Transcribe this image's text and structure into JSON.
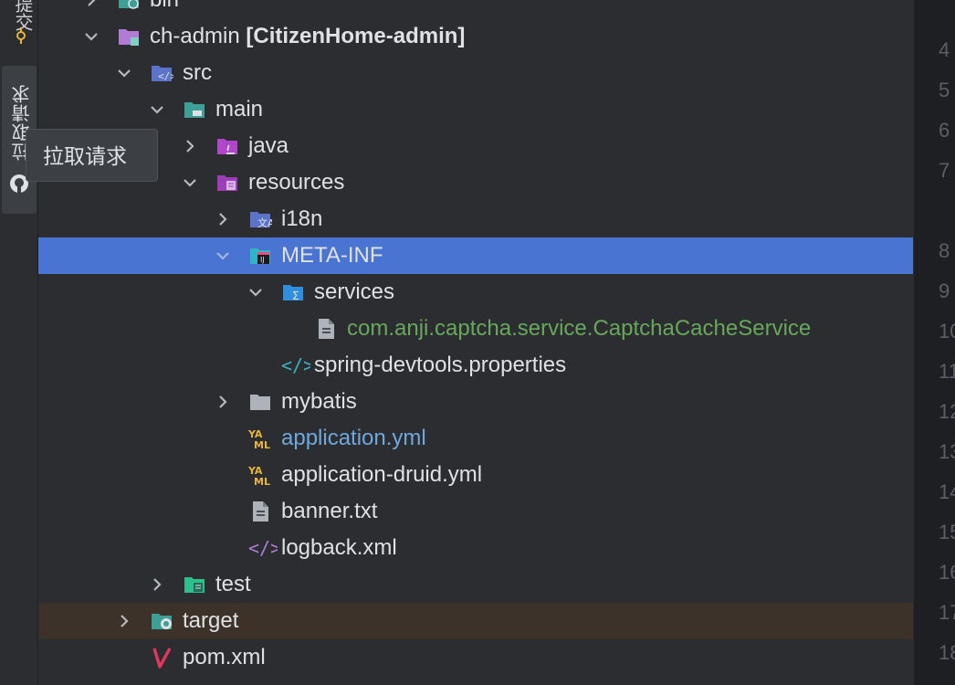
{
  "side_strip": {
    "top_label": "提交",
    "pull_requests_label": "拉取请求"
  },
  "tooltip": {
    "text": "拉取请求"
  },
  "tree": {
    "rows": [
      {
        "name": "bin",
        "project": ""
      },
      {
        "name": "ch-admin",
        "project": "[CitizenHome-admin]"
      },
      {
        "name": "src"
      },
      {
        "name": "main"
      },
      {
        "name": "java"
      },
      {
        "name": "resources"
      },
      {
        "name": "i18n"
      },
      {
        "name": "META-INF"
      },
      {
        "name": "services"
      },
      {
        "name": "com.anji.captcha.service.CaptchaCacheService"
      },
      {
        "name": "spring-devtools.properties"
      },
      {
        "name": "mybatis"
      },
      {
        "name": "application.yml"
      },
      {
        "name": "application-druid.yml"
      },
      {
        "name": "banner.txt"
      },
      {
        "name": "logback.xml"
      },
      {
        "name": "test"
      },
      {
        "name": "target"
      },
      {
        "name": "pom.xml"
      }
    ],
    "colors": {
      "selection": "#4a74d1",
      "excluded": "#3c3229",
      "modified": "#6fa8dc",
      "added": "#67a85b"
    }
  },
  "gutter": {
    "line_numbers": [
      "4",
      "5",
      "6",
      "7",
      "8",
      "9",
      "10",
      "11",
      "12",
      "13",
      "14",
      "15",
      "16",
      "17",
      "18"
    ]
  }
}
